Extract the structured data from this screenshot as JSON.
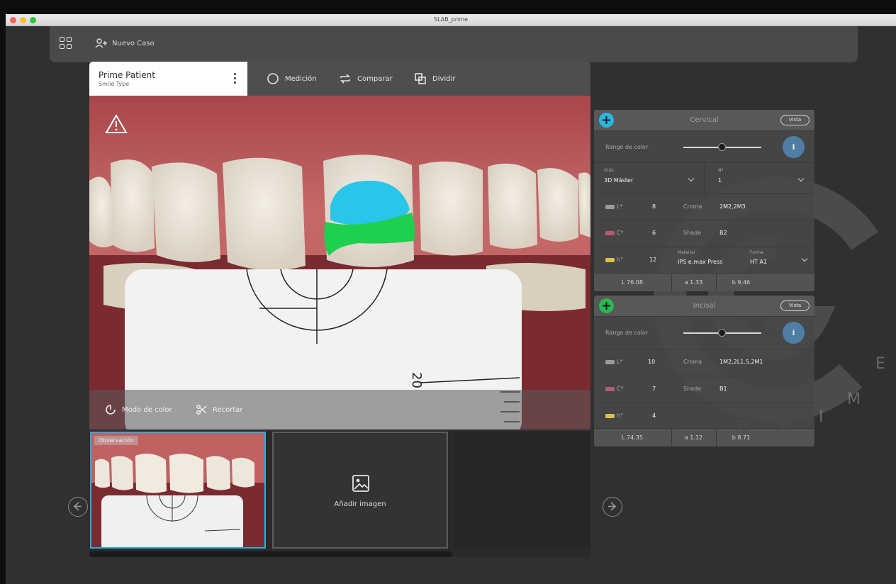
{
  "window": {
    "title": "SLAB_prime"
  },
  "toolbar": {
    "new_case_label": "Nuevo Caso"
  },
  "patient": {
    "name": "Prime Patient",
    "subtitle": "Smile Type"
  },
  "panel_actions": [
    {
      "label": "Medición",
      "icon": "ring-icon"
    },
    {
      "label": "Comparar",
      "icon": "swap-icon"
    },
    {
      "label": "Dividir",
      "icon": "split-icon"
    }
  ],
  "photo_bar": {
    "contrast_label": "Modo de color",
    "crop_label": "Recortar"
  },
  "thumbnails": {
    "badge": "Observación",
    "add_image_label": "Añadir imagen"
  },
  "colors": {
    "accent_cyan": "#29b6e0",
    "accent_green": "#2ab84f",
    "info_blue": "#4e7ea3"
  },
  "shade_panel_1": {
    "title": "Cervical",
    "pill": "Vista",
    "slider_label": "Rango de color",
    "slider_value_pct": 58,
    "info_label": "i",
    "select_left_label": "Guía",
    "select_left_value": "3D Máster",
    "select_right_label": "Nº",
    "select_right_value": "1",
    "rows": [
      {
        "key": "L*",
        "val": "8",
        "label": "Croma",
        "value": "2M2,2M3"
      },
      {
        "key": "C*",
        "val": "6",
        "label": "Shade",
        "value": "B2"
      },
      {
        "key": "h°",
        "val": "12",
        "sub_left_label": "Material",
        "sub_left_value": "IPS e.max Press",
        "sub_right_label": "Forma",
        "sub_right_value": "HT A1"
      }
    ],
    "footer": [
      "L 76.08",
      "a 1.33",
      "b 9.46"
    ]
  },
  "shade_panel_2": {
    "title": "Incisal",
    "pill": "Vista",
    "slider_label": "Rango de color",
    "slider_value_pct": 58,
    "info_label": "i",
    "rows": [
      {
        "key": "L*",
        "val": "10",
        "label": "Croma",
        "value": "1M2,2L1.5,2M1"
      },
      {
        "key": "C*",
        "val": "7",
        "label": "Shade",
        "value": "B1"
      },
      {
        "key": "h°",
        "val": "4"
      }
    ],
    "footer": [
      "L 74.35",
      "a 1.12",
      "b 8.71"
    ]
  },
  "watermark": {
    "letters": [
      "P",
      "R",
      "I",
      "M",
      "E"
    ]
  }
}
